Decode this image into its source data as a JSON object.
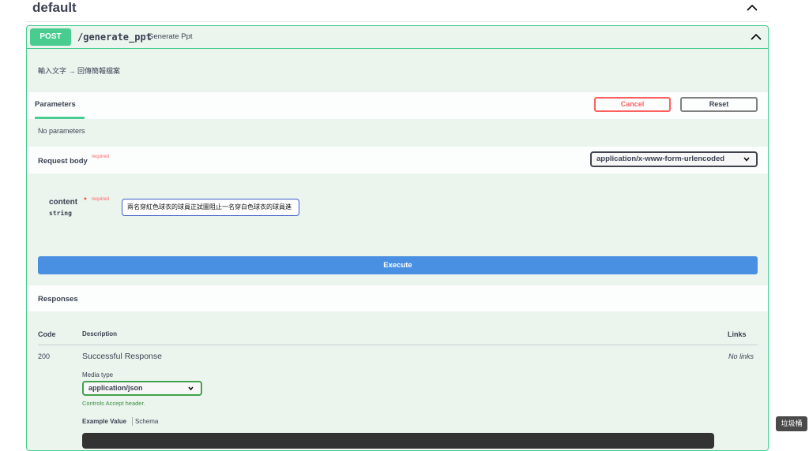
{
  "section": {
    "title": "default"
  },
  "operation": {
    "method": "POST",
    "path": "/generate_ppt",
    "summary": "Generate Ppt",
    "description": "輸入文字 → 回傳簡報檔案"
  },
  "parameters": {
    "tab_label": "Parameters",
    "cancel_label": "Cancel",
    "reset_label": "Reset",
    "empty_text": "No parameters"
  },
  "request_body": {
    "label": "Request body",
    "required": "required",
    "content_type": "application/x-www-form-urlencoded",
    "field": {
      "name": "content",
      "required_star": "*",
      "required": "required",
      "type": "string",
      "value": "兩名穿紅色球衣的球員正試圖阻止一名穿白色球衣的球員進"
    }
  },
  "execute_label": "Execute",
  "responses": {
    "label": "Responses",
    "headers": {
      "code": "Code",
      "description": "Description",
      "links": "Links"
    },
    "rows": [
      {
        "code": "200",
        "description": "Successful Response",
        "links": "No links",
        "media_type_label": "Media type",
        "media_type": "application/json",
        "accept_note": "Controls Accept header.",
        "example_tab": "Example Value",
        "schema_tab": "Schema"
      }
    ]
  },
  "tooltip": "垃圾桶",
  "colors": {
    "post": "#49cc90",
    "execute": "#4990e2",
    "cancel": "#ff6060"
  }
}
